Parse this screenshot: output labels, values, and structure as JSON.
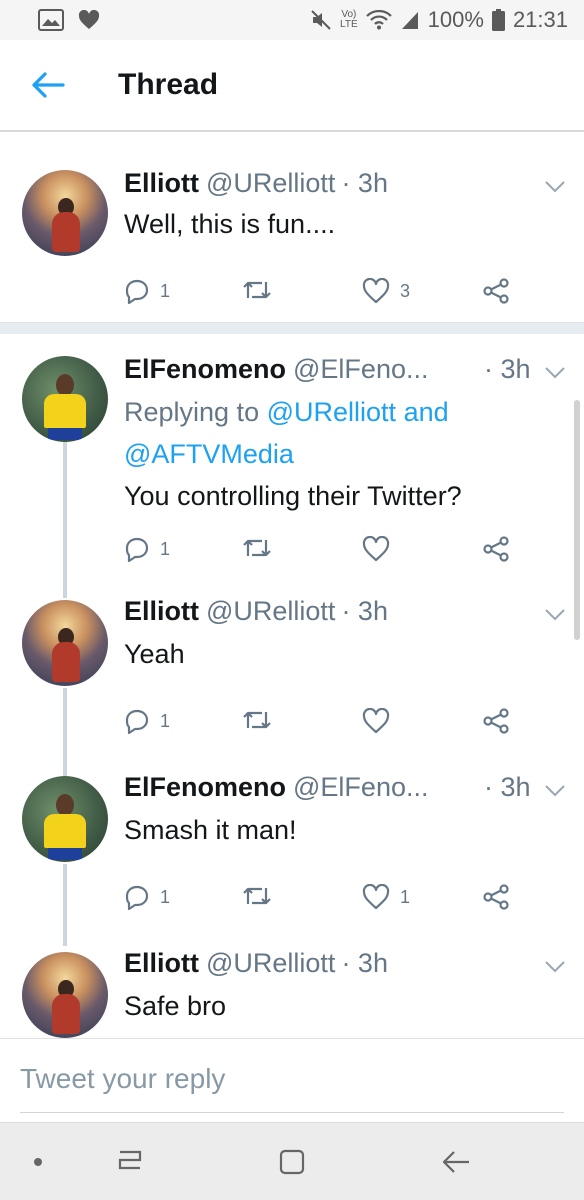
{
  "status_bar": {
    "lte_top": "Vo)",
    "lte_bottom": "LTE",
    "battery": "100%",
    "time": "21:31"
  },
  "app_bar": {
    "title": "Thread"
  },
  "tweets": [
    {
      "name": "Elliott",
      "handle": "@URelliott",
      "time": "· 3h",
      "text": "Well, this is fun....",
      "replies": "1",
      "retweets": "",
      "likes": "3"
    },
    {
      "name": "ElFenomeno",
      "handle": "@ElFeno...",
      "time": "· 3h",
      "replying_prefix": "Replying to",
      "replying_user1": "@URelliott",
      "replying_and": "and",
      "replying_user2": "@AFTVMedia",
      "text": "You controlling their Twitter?",
      "replies": "1",
      "retweets": "",
      "likes": ""
    },
    {
      "name": "Elliott",
      "handle": "@URelliott",
      "time": "· 3h",
      "text": "Yeah",
      "replies": "1",
      "retweets": "",
      "likes": ""
    },
    {
      "name": "ElFenomeno",
      "handle": "@ElFeno...",
      "time": "· 3h",
      "text": "Smash it man!",
      "replies": "1",
      "retweets": "",
      "likes": "1"
    },
    {
      "name": "Elliott",
      "handle": "@URelliott",
      "time": "· 3h",
      "text": "Safe bro"
    }
  ],
  "reply_bar": {
    "placeholder": "Tweet your reply"
  },
  "colors": {
    "accent": "#1da1f2",
    "secondary_text": "#657786",
    "divider": "#e6ecf0"
  }
}
